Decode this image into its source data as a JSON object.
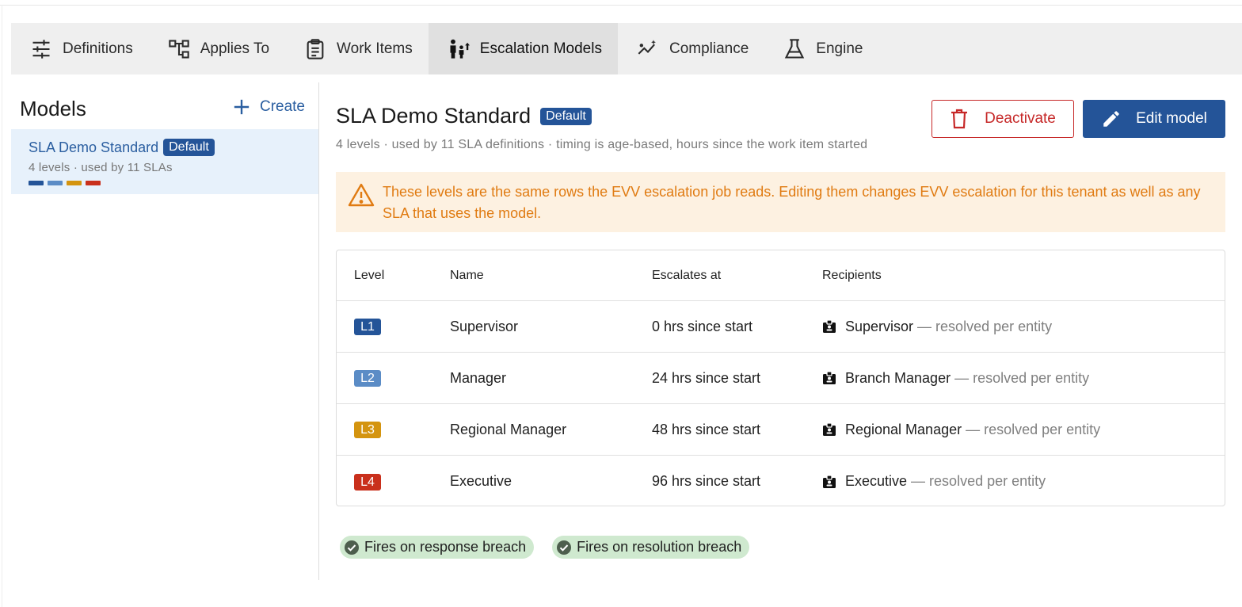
{
  "tabs": [
    {
      "label": "Definitions",
      "icon": "sliders-icon"
    },
    {
      "label": "Applies To",
      "icon": "hierarchy-icon"
    },
    {
      "label": "Work Items",
      "icon": "clipboard-icon"
    },
    {
      "label": "Escalation Models",
      "icon": "escalation-people-icon",
      "active": true
    },
    {
      "label": "Compliance",
      "icon": "trend-sparkle-icon"
    },
    {
      "label": "Engine",
      "icon": "flask-icon"
    }
  ],
  "sidebar": {
    "heading": "Models",
    "create_label": "Create",
    "items": [
      {
        "name": "SLA Demo Standard",
        "badge": "Default",
        "summary": "4 levels · used by 11 SLAs",
        "level_colors": [
          "#245498",
          "#5b8cc6",
          "#d4940f",
          "#c9301c"
        ]
      }
    ]
  },
  "main": {
    "title": "SLA Demo Standard",
    "badge": "Default",
    "subtitle": "4 levels · used by 11 SLA definitions · timing is age-based, hours since the work item started",
    "deactivate_label": "Deactivate",
    "edit_label": "Edit model",
    "warning": "These levels are the same rows the EVV escalation job reads. Editing them changes EVV escalation for this tenant as well as any SLA that uses the model.",
    "table": {
      "headers": [
        "Level",
        "Name",
        "Escalates at",
        "Recipients"
      ],
      "rows": [
        {
          "level": "L1",
          "color": "#245498",
          "name": "Supervisor",
          "escalates": "0 hrs since start",
          "recipient": "Supervisor",
          "note": "— resolved per entity"
        },
        {
          "level": "L2",
          "color": "#5b8cc6",
          "name": "Manager",
          "escalates": "24 hrs since start",
          "recipient": "Branch Manager",
          "note": "— resolved per entity"
        },
        {
          "level": "L3",
          "color": "#d4940f",
          "name": "Regional Manager",
          "escalates": "48 hrs since start",
          "recipient": "Regional Manager",
          "note": "— resolved per entity"
        },
        {
          "level": "L4",
          "color": "#c9301c",
          "name": "Executive",
          "escalates": "96 hrs since start",
          "recipient": "Executive",
          "note": "— resolved per entity"
        }
      ]
    },
    "chips": [
      "Fires on response breach",
      "Fires on resolution breach"
    ]
  }
}
